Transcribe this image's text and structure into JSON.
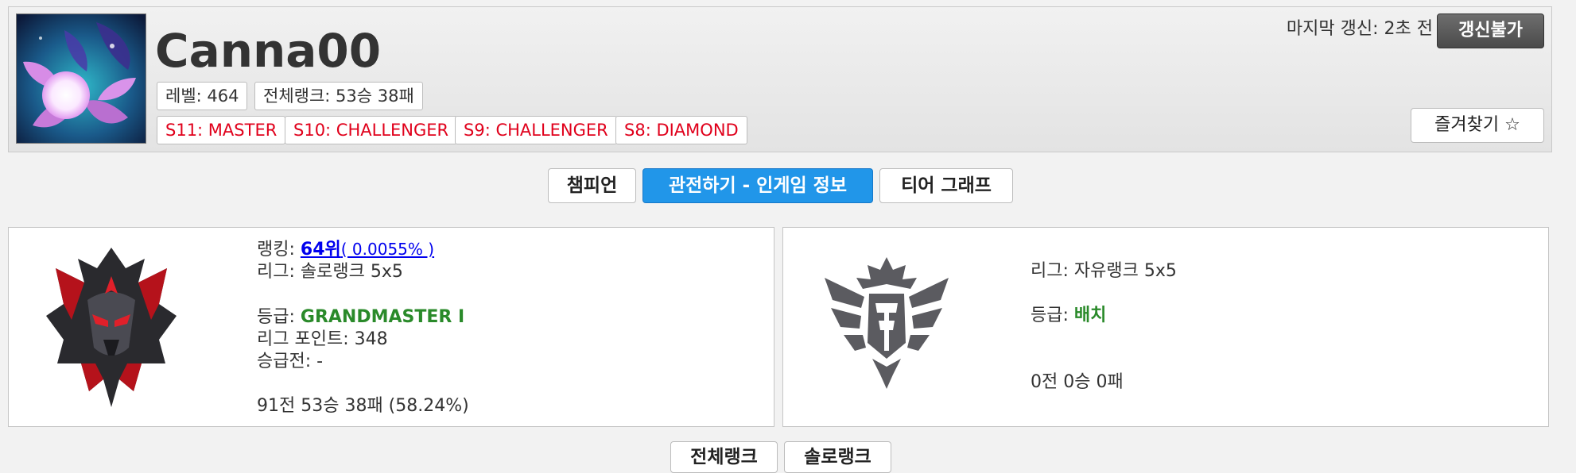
{
  "profile": {
    "name": "Canna00",
    "level_label": "레벨: 464",
    "total_rank_label": "전체랭크: 53승 38패",
    "season_badges": [
      "S11: MASTER",
      "S10: CHALLENGER",
      "S9: CHALLENGER",
      "S8: DIAMOND"
    ],
    "last_update": "마지막 갱신: 2초 전",
    "refresh_label": "갱신불가",
    "favorite_label": "즐겨찾기 ☆"
  },
  "tabs": [
    {
      "label": "챔피언",
      "active": false
    },
    {
      "label": "관전하기 - 인게임 정보",
      "active": true
    },
    {
      "label": "티어 그래프",
      "active": false
    }
  ],
  "solo": {
    "ranking_prefix": "랭킹: ",
    "ranking_place": "64위",
    "ranking_percent": "( 0.0055% )",
    "league": "리그: 솔로랭크 5x5",
    "tier_prefix": "등급: ",
    "tier_value": "GRANDMASTER I",
    "league_points": "리그 포인트: 348",
    "promotion": "승급전: -",
    "record": "91전 53승 38패 (58.24%)"
  },
  "flex": {
    "league": "리그: 자유랭크 5x5",
    "tier_prefix": "등급: ",
    "tier_value": "배치",
    "record": "0전 0승 0패"
  },
  "bottom_tabs": [
    "전체랭크",
    "솔로랭크"
  ],
  "colors": {
    "accent": "#2196e9",
    "season_red": "#e0001b",
    "tier_green": "#2a8a2a"
  }
}
